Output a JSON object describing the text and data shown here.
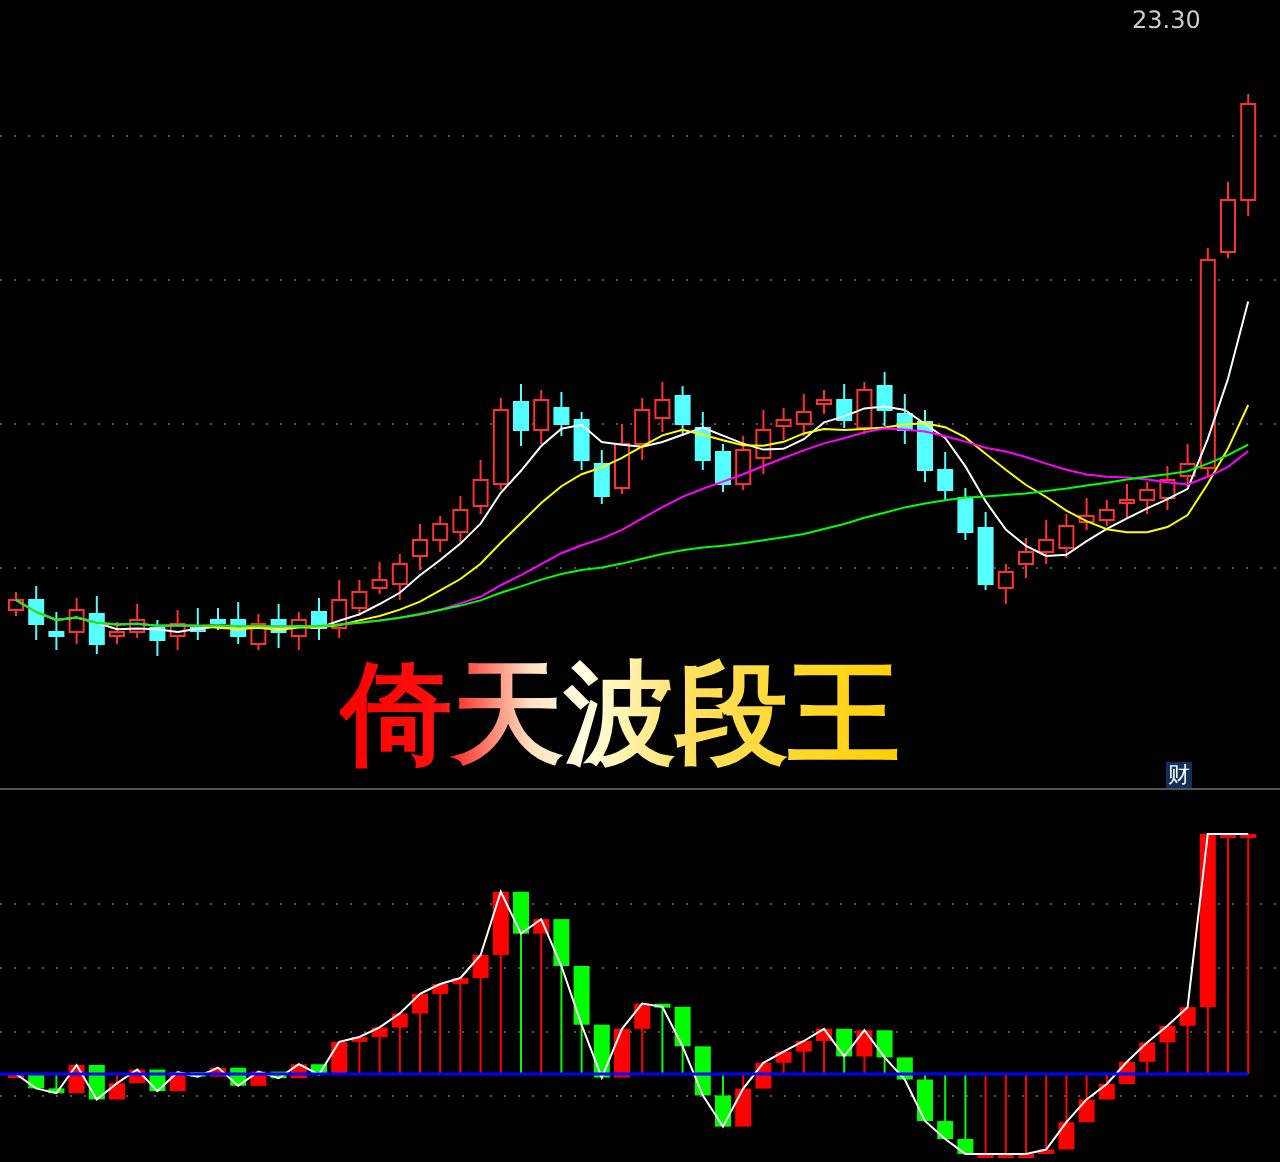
{
  "price_chart": {
    "price_label": "23.30",
    "title": "倚天波段王",
    "indicator_tag": "财"
  }
}
